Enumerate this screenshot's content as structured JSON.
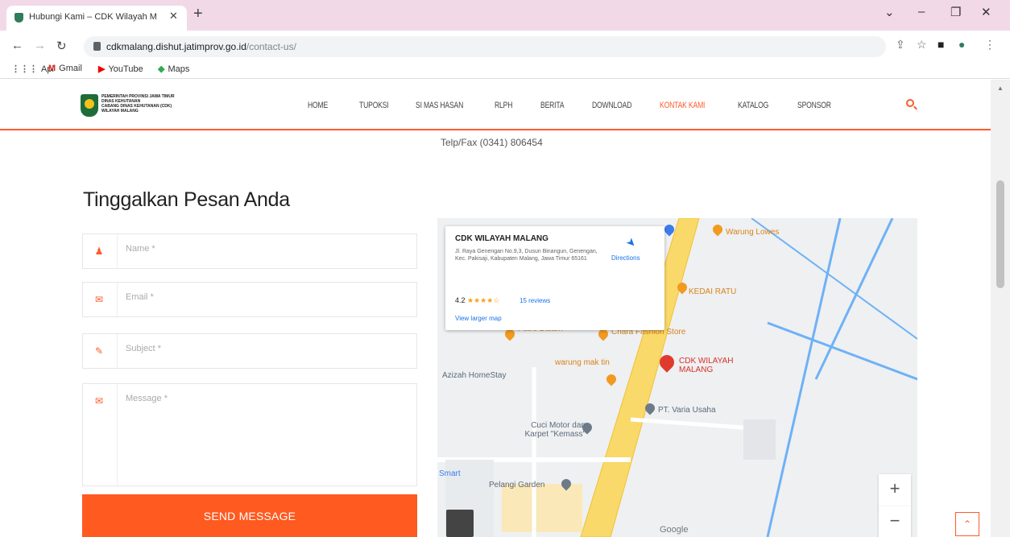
{
  "browser": {
    "tab_title": "Hubungi Kami – CDK Wilayah M",
    "tab_close": "✕",
    "new_tab": "+",
    "url_host": "cdkmalang.dishut.jatimprov.go.id",
    "url_path": "/contact-us/",
    "bookmarks": [
      {
        "icon": "⋮⋮⋮",
        "label": "Apl"
      },
      {
        "icon": "M",
        "label": "Gmail"
      },
      {
        "icon": "▶",
        "label": "YouTube"
      },
      {
        "icon": "◆",
        "label": "Maps"
      }
    ],
    "accent": "#f2d9e8"
  },
  "site": {
    "logo_lines": [
      "PEMERINTAH PROVINSI JAWA TIMUR",
      "DINAS KEHUTANAN",
      "CABANG DINAS KEHUTANAN (CDK)",
      "WILAYAH MALANG"
    ],
    "nav": [
      "HOME",
      "TUPOKSI",
      "SI MAS HASAN",
      "RLPH",
      "BERITA",
      "DOWNLOAD",
      "KONTAK KAMI",
      "KATALOG",
      "SPONSOR"
    ],
    "active_nav": "KONTAK KAMI",
    "accent_color": "#ff5a2c"
  },
  "contact": {
    "telp": "Telp/Fax (0341) 806454",
    "heading": "Tinggalkan Pesan Anda",
    "fields": {
      "name_placeholder": "Name *",
      "email_placeholder": "Email *",
      "subject_placeholder": "Subject *",
      "message_placeholder": "Message *"
    },
    "send_label": "SEND MESSAGE"
  },
  "map": {
    "card_title": "CDK WILAYAH MALANG",
    "card_address": "Jl. Raya Genengan No.9,3, Dusun Binangun, Genengan, Kec. Pakisaji, Kabupaten Malang, Jawa Timur 65161",
    "rating": "4.2",
    "stars": "★★★★☆",
    "reviews": "15 reviews",
    "directions": "Directions",
    "view_larger": "View larger map",
    "labels": {
      "warung_lowes": "Warung Lowes",
      "kedai_ratu": "KEDAI RATU",
      "putro_dalam": "Putro Dalam",
      "chara": "Chara Fashion Store",
      "cdk_marker": "CDK WILAYAH MALANG",
      "warung_mak": "warung mak tin",
      "azizah": "Azizah HomeStay",
      "varia": "PT. Varia Usaha",
      "cuci_motor": "Cuci Motor dan Karpet \"Kemass\"",
      "pelangi": "Pelangi Garden",
      "smart": "Smart",
      "google": "Google"
    },
    "zoom_in": "+",
    "zoom_out": "−"
  },
  "scroll_top_label": "⌃"
}
